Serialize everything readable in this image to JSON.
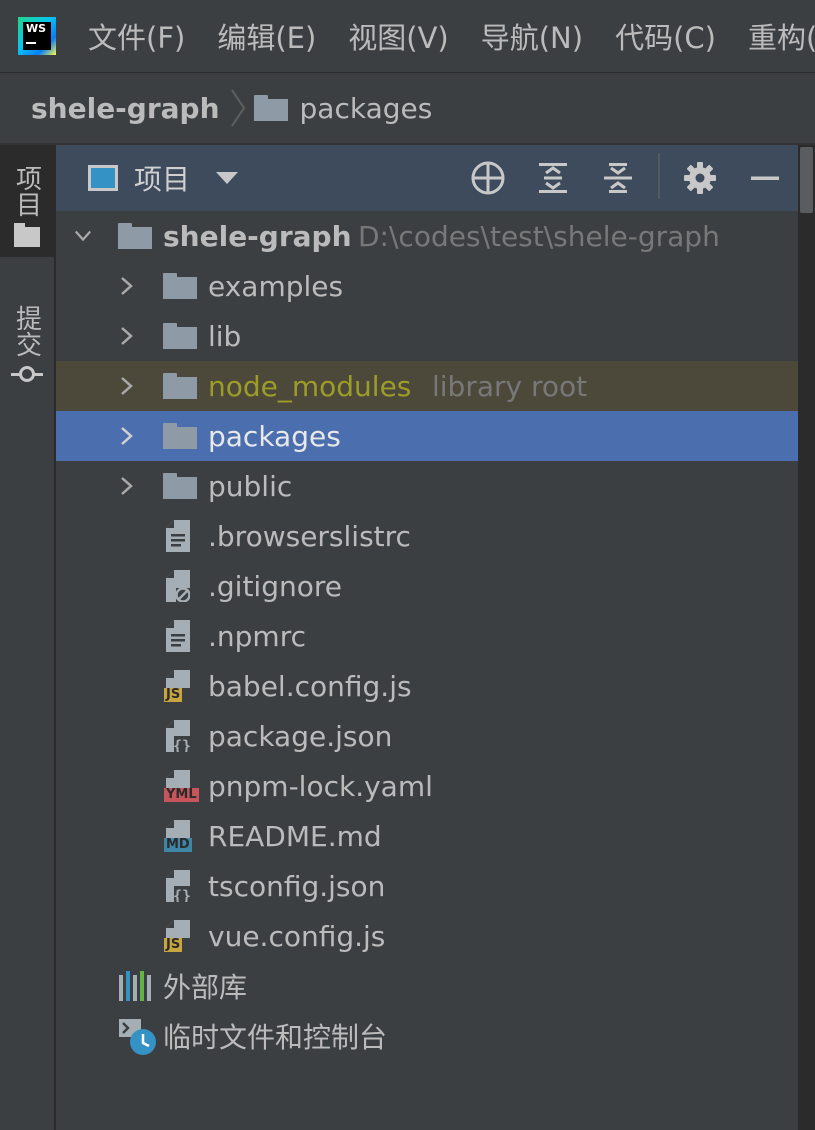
{
  "app": {
    "logo_text": "WS"
  },
  "menu": [
    "文件(F)",
    "编辑(E)",
    "视图(V)",
    "导航(N)",
    "代码(C)",
    "重构("
  ],
  "breadcrumb": {
    "root": "shele-graph",
    "leaf": "packages"
  },
  "toolstrip": {
    "project_tab": "项目",
    "commit_tab": "提交"
  },
  "panel": {
    "title": "项目",
    "actions": [
      "locate-icon",
      "expand-all-icon",
      "collapse-all-icon",
      "gear-icon",
      "minimize-icon"
    ]
  },
  "tree": {
    "root": {
      "name": "shele-graph",
      "path": "D:\\codes\\test\\shele-graph"
    },
    "folders": [
      {
        "name": "examples"
      },
      {
        "name": "lib"
      },
      {
        "name": "node_modules",
        "hint": "library root"
      },
      {
        "name": "packages"
      },
      {
        "name": "public"
      }
    ],
    "files": [
      {
        "name": ".browserslistrc",
        "type": "text"
      },
      {
        "name": ".gitignore",
        "type": "ignore"
      },
      {
        "name": ".npmrc",
        "type": "text"
      },
      {
        "name": "babel.config.js",
        "type": "js",
        "badge": "JS"
      },
      {
        "name": "package.json",
        "type": "json"
      },
      {
        "name": "pnpm-lock.yaml",
        "type": "yaml",
        "badge": "YML"
      },
      {
        "name": "README.md",
        "type": "md",
        "badge": "MD"
      },
      {
        "name": "tsconfig.json",
        "type": "json"
      },
      {
        "name": "vue.config.js",
        "type": "js",
        "badge": "JS"
      }
    ],
    "external_libraries": "外部库",
    "scratches": "临时文件和控制台"
  },
  "colors": {
    "selection": "#4b6eaf",
    "library_root_bg": "#4c483a",
    "library_root_text": "#9c9c29",
    "js_badge": "#c9a53f",
    "yaml_badge": "#c7555b",
    "md_badge": "#3e86a6"
  }
}
